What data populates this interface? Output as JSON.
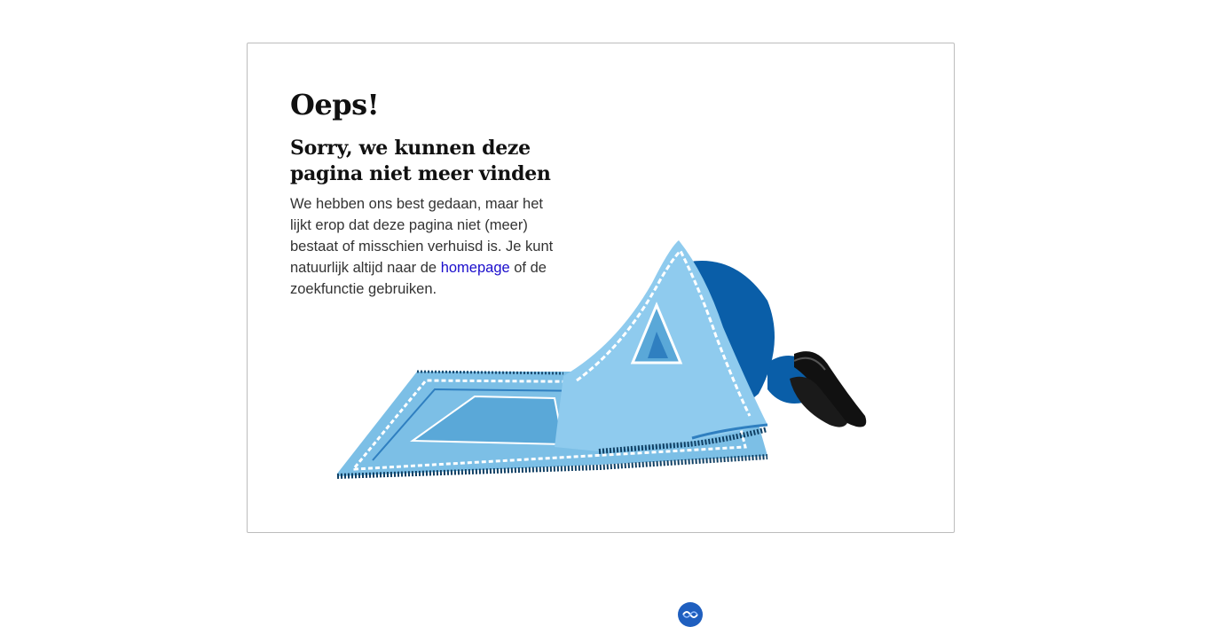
{
  "error": {
    "title": "Oeps!",
    "subtitle": "Sorry, we kunnen deze pagina niet meer vinden",
    "body_before_link": "We hebben ons best gedaan, maar het lijkt erop dat deze pagina niet (meer) bestaat of misschien verhuisd is. Je kunt natuurlijk altijd naar de ",
    "link_text": "homepage",
    "body_after_link": " of de zoekfunctie gebruiken."
  },
  "illustration": {
    "icon": "hidden-under-rug-illustration",
    "rug_color": "#7cbfe6",
    "character_color": "#0a5ea8"
  },
  "footer": {
    "logo_icon": "brand-logo-icon",
    "logo_color": "#1f5fbf"
  }
}
